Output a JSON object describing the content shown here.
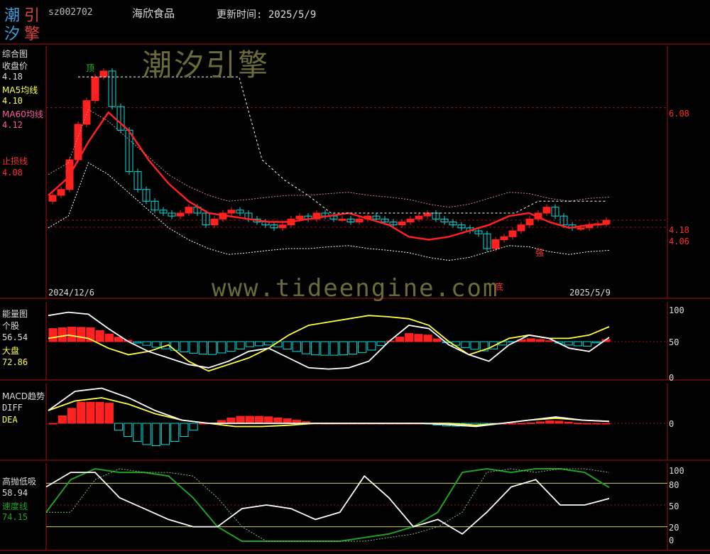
{
  "header": {
    "logo_chars": [
      "潮",
      "引",
      "汐",
      "擎"
    ],
    "code": "sz002702",
    "name": "海欣食品",
    "updated": "更新时间: 2025/5/9"
  },
  "watermarks": {
    "brand": "潮汐引擎",
    "url": "www.tideengine.com"
  },
  "panels": {
    "main": {
      "title": "综合图",
      "close_label": "收盘价",
      "close_value": "4.18",
      "ma5_label": "MA5均线",
      "ma5_value": "4.10",
      "ma60_label": "MA60均线",
      "ma60_value": "4.12",
      "stop_label": "止损线",
      "stop_value": "4.08",
      "date_start": "2024/12/6",
      "date_end": "2025/5/9",
      "ann_top": "顶",
      "ann_bottom": "底",
      "ann_strong": "强",
      "right_ticks": [
        "6.08",
        "4.18",
        "4.06"
      ]
    },
    "energy": {
      "title": "能量图",
      "stock_label": "个股",
      "stock_value": "56.54",
      "market_label": "大盘",
      "market_value": "72.86",
      "right_ticks": [
        "100",
        "50",
        "0"
      ]
    },
    "macd": {
      "title": "MACD趋势",
      "diff_label": "DIFF",
      "dea_label": "DEA",
      "right_ticks": [
        "0"
      ]
    },
    "osc": {
      "title": "高抛低吸",
      "value": "58.94",
      "speed_label": "速度线",
      "speed_value": "74.15",
      "right_ticks": [
        "100",
        "80",
        "50",
        "20",
        "0"
      ]
    }
  },
  "colors": {
    "up": "#ff2020",
    "down": "#00e0e0",
    "ma": "#ff2020",
    "grid": "#a01010",
    "white": "#ffffff",
    "yellow": "#ffff40",
    "green": "#20a020"
  },
  "chart_data": [
    {
      "type": "candlestick",
      "title": "综合图",
      "x_range": [
        "2024/12/6",
        "2025/5/9"
      ],
      "ylim": [
        3.4,
        7.0
      ],
      "reference_levels": [
        6.08,
        4.18,
        4.06
      ],
      "series": [
        {
          "name": "收盘价",
          "values": [
            4.6,
            4.7,
            5.2,
            5.8,
            6.2,
            6.6,
            6.7,
            6.1,
            5.7,
            5.0,
            4.7,
            4.5,
            4.35,
            4.3,
            4.25,
            4.3,
            4.4,
            4.3,
            4.1,
            4.2,
            4.3,
            4.35,
            4.3,
            4.2,
            4.15,
            4.1,
            4.05,
            4.1,
            4.2,
            4.25,
            4.2,
            4.3,
            4.25,
            4.2,
            4.2,
            4.15,
            4.2,
            4.25,
            4.2,
            4.15,
            4.1,
            4.15,
            4.2,
            4.25,
            4.3,
            4.2,
            4.15,
            4.1,
            4.05,
            4.0,
            3.95,
            3.7,
            3.85,
            3.9,
            4.0,
            4.1,
            4.2,
            4.3,
            4.4,
            4.25,
            4.1,
            4.05,
            4.05,
            4.1,
            4.12,
            4.18
          ]
        },
        {
          "name": "MA5均线",
          "values": [
            4.6,
            4.9,
            5.5,
            6.0,
            5.7,
            5.2,
            4.8,
            4.5,
            4.3,
            4.25,
            4.2,
            4.15,
            4.15,
            4.2,
            4.25,
            4.3,
            4.2,
            4.1,
            3.9,
            3.85,
            3.9,
            4.0,
            4.1,
            4.25,
            4.3,
            4.15,
            4.05,
            4.1,
            4.12
          ]
        },
        {
          "name": "MA60均线",
          "values": [
            4.5,
            4.7,
            5.6,
            5.4,
            5.1,
            4.8,
            4.5,
            4.3,
            4.15,
            4.05,
            4.08,
            4.12,
            4.15,
            4.15,
            4.18,
            4.2,
            4.15,
            4.12,
            4.08,
            4.0,
            3.95,
            4.0,
            4.1,
            4.2,
            4.18,
            4.1,
            4.05,
            4.1,
            4.12
          ]
        },
        {
          "name": "止损线",
          "values": [
            6.6,
            6.6,
            6.6,
            6.6,
            6.6,
            6.6,
            6.6,
            6.6,
            5.2,
            4.85,
            4.6,
            4.3,
            4.3,
            4.3,
            4.3,
            4.3,
            4.3,
            4.3,
            4.3,
            4.3,
            4.5,
            4.5,
            4.5,
            4.5
          ]
        }
      ]
    },
    {
      "type": "bar",
      "title": "能量图",
      "ylim": [
        0,
        100
      ],
      "series": [
        {
          "name": "个股",
          "values": [
            90,
            95,
            92,
            70,
            50,
            35,
            25,
            15,
            10,
            20,
            35,
            40,
            25,
            10,
            8,
            10,
            20,
            50,
            75,
            70,
            45,
            30,
            20,
            45,
            60,
            55,
            40,
            35,
            56.54
          ]
        },
        {
          "name": "大盘",
          "values": [
            55,
            60,
            55,
            40,
            30,
            35,
            45,
            20,
            5,
            15,
            25,
            40,
            60,
            75,
            80,
            85,
            90,
            88,
            85,
            75,
            50,
            30,
            40,
            55,
            60,
            55,
            55,
            60,
            72.86
          ]
        }
      ]
    },
    {
      "type": "line",
      "title": "MACD趋势",
      "series": [
        {
          "name": "DIFF",
          "values": [
            0.2,
            0.5,
            0.55,
            0.4,
            0.2,
            0.05,
            0.0,
            0.0,
            0.0,
            0.0,
            0.0,
            0.0,
            0.0,
            0.0,
            0.0,
            -0.02,
            -0.05,
            0.0,
            0.05,
            0.1,
            0.05,
            0.03
          ]
        },
        {
          "name": "DEA",
          "values": [
            0.2,
            0.35,
            0.4,
            0.3,
            0.15,
            0.05,
            0.0,
            -0.05,
            -0.05,
            -0.03,
            0.0,
            0.0,
            0.0,
            0.0,
            0.0,
            0.0,
            -0.03,
            0.0,
            0.05,
            0.08,
            0.05,
            0.03
          ]
        }
      ]
    },
    {
      "type": "line",
      "title": "高抛低吸",
      "ylim": [
        0,
        100
      ],
      "series": [
        {
          "name": "高抛低吸",
          "values": [
            75,
            95,
            95,
            60,
            45,
            30,
            20,
            20,
            45,
            50,
            45,
            30,
            40,
            90,
            60,
            20,
            30,
            10,
            40,
            75,
            85,
            50,
            50,
            58.94
          ]
        },
        {
          "name": "速度线",
          "values": [
            40,
            85,
            100,
            95,
            95,
            90,
            60,
            20,
            0,
            0,
            0,
            0,
            0,
            5,
            10,
            20,
            40,
            95,
            100,
            95,
            100,
            100,
            95,
            74.15
          ]
        }
      ]
    }
  ]
}
